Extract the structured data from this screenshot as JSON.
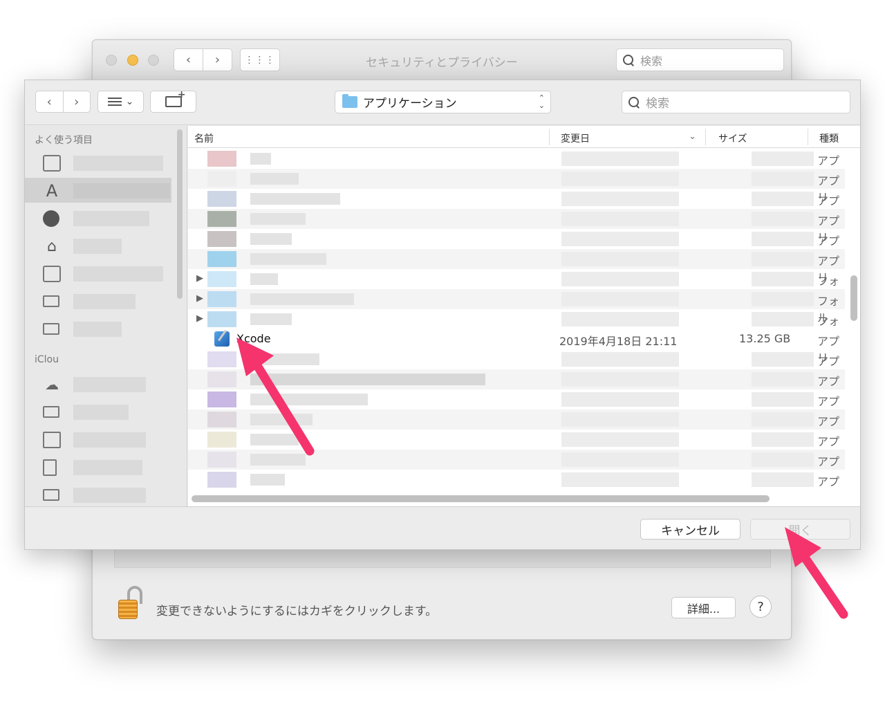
{
  "prefs_window": {
    "title": "セキュリティとプライバシー",
    "search_placeholder": "検索",
    "lock_message": "変更できないようにするにはカギをクリックします。",
    "detail_button": "詳細...",
    "help_button": "?"
  },
  "dialog": {
    "location": "アプリケーション",
    "search_placeholder": "検索",
    "sidebar": {
      "favorites_header": "よく使う項目",
      "icloud_header": "iClou"
    },
    "columns": {
      "name": "名前",
      "date": "変更日",
      "size": "サイズ",
      "kind": "種類"
    },
    "rows": [
      {
        "kind": "アプリ",
        "expandable": false
      },
      {
        "kind": "アプリ",
        "expandable": false
      },
      {
        "kind": "アプリ",
        "expandable": false
      },
      {
        "kind": "アプリ",
        "expandable": false
      },
      {
        "kind": "アプリ",
        "expandable": false
      },
      {
        "kind": "アプリ",
        "expandable": false
      },
      {
        "kind": "フォル",
        "expandable": true
      },
      {
        "kind": "フォル",
        "expandable": true
      },
      {
        "kind": "フォル",
        "expandable": true
      }
    ],
    "selected_row": {
      "name": "Xcode",
      "date": "2019年4月18日 21:11",
      "size": "13.25 GB",
      "kind": "アプリ"
    },
    "rows_after": [
      {
        "kind": "アプ"
      },
      {
        "kind": "アプ"
      },
      {
        "kind": "アプ"
      },
      {
        "kind": "アプ"
      },
      {
        "kind": "アプ"
      },
      {
        "kind": "アプ"
      },
      {
        "kind": "アプ"
      }
    ],
    "cancel_button": "キャンセル",
    "open_button": "開く"
  },
  "colors": {
    "annotation_arrow": "#f5336d",
    "traffic_yellow": "#f4bf4f"
  }
}
